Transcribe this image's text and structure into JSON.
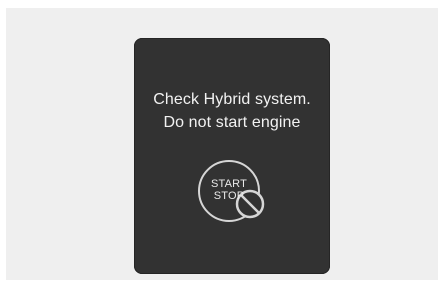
{
  "display": {
    "message_line1": "Check Hybrid system.",
    "message_line2": "Do not start engine",
    "start_stop_button": {
      "line1": "START",
      "line2": "STOP",
      "icon": "prohibited-icon"
    }
  },
  "colors": {
    "page_background": "#efefef",
    "display_background": "#323232",
    "text": "#f2f2f2",
    "button_ring": "#d6d6d6"
  }
}
